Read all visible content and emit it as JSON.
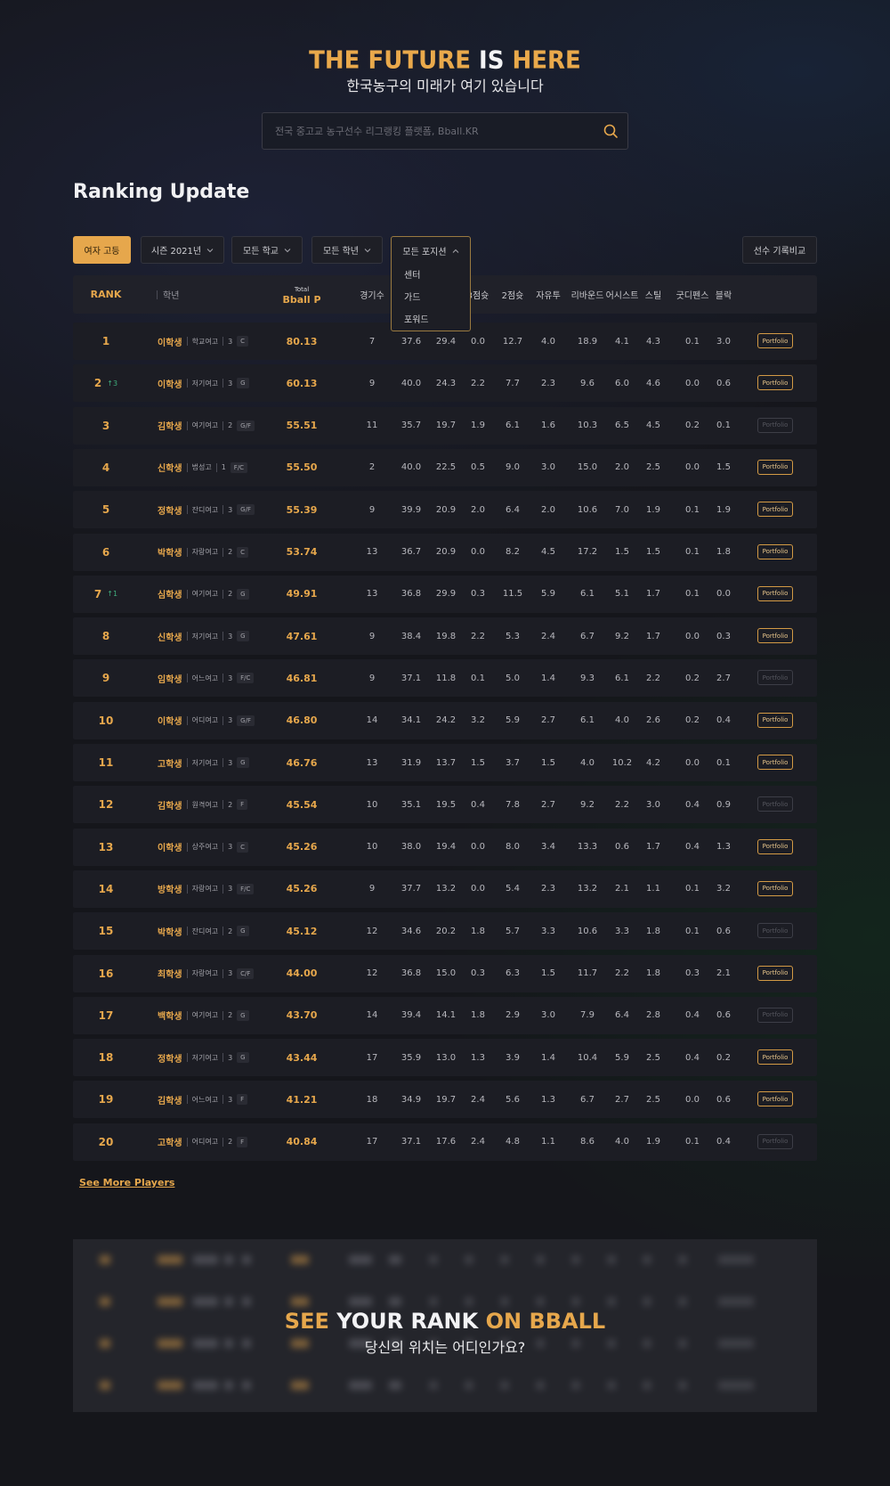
{
  "hero": {
    "title_a": "THE FUTURE",
    "title_b": "IS",
    "title_c": "HERE",
    "subtitle": "한국농구의 미래가 여기 있습니다"
  },
  "search": {
    "placeholder": "전국 중고교 농구선수 리그랭킹 플랫폼, Bball.KR",
    "icon": "search-icon"
  },
  "section_title": "Ranking Update",
  "filters": {
    "division": "여자 고등",
    "season": "시즌 2021년",
    "school": "모든 학교",
    "grade": "모든 학년",
    "position": "모든 포지션",
    "compare": "선수 기록비교"
  },
  "position_dropdown": {
    "options": [
      "센터",
      "가드",
      "포워드"
    ]
  },
  "table": {
    "columns": {
      "rank": "RANK",
      "year": "학년",
      "bp_small": "Total",
      "bp_big": "Bball P",
      "games": "경기수",
      "three": "3점슛",
      "two": "2점슛",
      "ft": "자유투",
      "reb": "리바운드",
      "ast": "어시스트",
      "stl": "스틸",
      "def": "굿디펜스",
      "blk": "블락"
    },
    "portfolio_label": "Portfolio",
    "rows": [
      {
        "rank": "1",
        "up": "",
        "name": "이학생",
        "school": "학교여고",
        "grade": "3",
        "pos": "C",
        "bp": "80.13",
        "g": "7",
        "a": "37.6",
        "b": "29.4",
        "s3": "0.0",
        "s2": "12.7",
        "ft": "4.0",
        "reb": "18.9",
        "ast": "4.1",
        "stl": "4.3",
        "def": "0.1",
        "blk": "3.0",
        "pf": true
      },
      {
        "rank": "2",
        "up": "↑3",
        "name": "이학생",
        "school": "저기여고",
        "grade": "3",
        "pos": "G",
        "bp": "60.13",
        "g": "9",
        "a": "40.0",
        "b": "24.3",
        "s3": "2.2",
        "s2": "7.7",
        "ft": "2.3",
        "reb": "9.6",
        "ast": "6.0",
        "stl": "4.6",
        "def": "0.0",
        "blk": "0.6",
        "pf": true
      },
      {
        "rank": "3",
        "up": "",
        "name": "김학생",
        "school": "여기여고",
        "grade": "2",
        "pos": "G/F",
        "bp": "55.51",
        "g": "11",
        "a": "35.7",
        "b": "19.7",
        "s3": "1.9",
        "s2": "6.1",
        "ft": "1.6",
        "reb": "10.3",
        "ast": "6.5",
        "stl": "4.5",
        "def": "0.2",
        "blk": "0.1",
        "pf": false
      },
      {
        "rank": "4",
        "up": "",
        "name": "신학생",
        "school": "법성고",
        "grade": "1",
        "pos": "F/C",
        "bp": "55.50",
        "g": "2",
        "a": "40.0",
        "b": "22.5",
        "s3": "0.5",
        "s2": "9.0",
        "ft": "3.0",
        "reb": "15.0",
        "ast": "2.0",
        "stl": "2.5",
        "def": "0.0",
        "blk": "1.5",
        "pf": true
      },
      {
        "rank": "5",
        "up": "",
        "name": "정학생",
        "school": "잔디여고",
        "grade": "3",
        "pos": "G/F",
        "bp": "55.39",
        "g": "9",
        "a": "39.9",
        "b": "20.9",
        "s3": "2.0",
        "s2": "6.4",
        "ft": "2.0",
        "reb": "10.6",
        "ast": "7.0",
        "stl": "1.9",
        "def": "0.1",
        "blk": "1.9",
        "pf": true
      },
      {
        "rank": "6",
        "up": "",
        "name": "박학생",
        "school": "자랑여고",
        "grade": "2",
        "pos": "C",
        "bp": "53.74",
        "g": "13",
        "a": "36.7",
        "b": "20.9",
        "s3": "0.0",
        "s2": "8.2",
        "ft": "4.5",
        "reb": "17.2",
        "ast": "1.5",
        "stl": "1.5",
        "def": "0.1",
        "blk": "1.8",
        "pf": true
      },
      {
        "rank": "7",
        "up": "↑1",
        "name": "심학생",
        "school": "여기여고",
        "grade": "2",
        "pos": "G",
        "bp": "49.91",
        "g": "13",
        "a": "36.8",
        "b": "29.9",
        "s3": "0.3",
        "s2": "11.5",
        "ft": "5.9",
        "reb": "6.1",
        "ast": "5.1",
        "stl": "1.7",
        "def": "0.1",
        "blk": "0.0",
        "pf": true
      },
      {
        "rank": "8",
        "up": "",
        "name": "신학생",
        "school": "저기여고",
        "grade": "3",
        "pos": "G",
        "bp": "47.61",
        "g": "9",
        "a": "38.4",
        "b": "19.8",
        "s3": "2.2",
        "s2": "5.3",
        "ft": "2.4",
        "reb": "6.7",
        "ast": "9.2",
        "stl": "1.7",
        "def": "0.0",
        "blk": "0.3",
        "pf": true
      },
      {
        "rank": "9",
        "up": "",
        "name": "임학생",
        "school": "어느여고",
        "grade": "3",
        "pos": "F/C",
        "bp": "46.81",
        "g": "9",
        "a": "37.1",
        "b": "11.8",
        "s3": "0.1",
        "s2": "5.0",
        "ft": "1.4",
        "reb": "9.3",
        "ast": "6.1",
        "stl": "2.2",
        "def": "0.2",
        "blk": "2.7",
        "pf": false
      },
      {
        "rank": "10",
        "up": "",
        "name": "이학생",
        "school": "어디여고",
        "grade": "3",
        "pos": "G/F",
        "bp": "46.80",
        "g": "14",
        "a": "34.1",
        "b": "24.2",
        "s3": "3.2",
        "s2": "5.9",
        "ft": "2.7",
        "reb": "6.1",
        "ast": "4.0",
        "stl": "2.6",
        "def": "0.2",
        "blk": "0.4",
        "pf": true
      },
      {
        "rank": "11",
        "up": "",
        "name": "고학생",
        "school": "저기여고",
        "grade": "3",
        "pos": "G",
        "bp": "46.76",
        "g": "13",
        "a": "31.9",
        "b": "13.7",
        "s3": "1.5",
        "s2": "3.7",
        "ft": "1.5",
        "reb": "4.0",
        "ast": "10.2",
        "stl": "4.2",
        "def": "0.0",
        "blk": "0.1",
        "pf": true
      },
      {
        "rank": "12",
        "up": "",
        "name": "김학생",
        "school": "원격여고",
        "grade": "2",
        "pos": "F",
        "bp": "45.54",
        "g": "10",
        "a": "35.1",
        "b": "19.5",
        "s3": "0.4",
        "s2": "7.8",
        "ft": "2.7",
        "reb": "9.2",
        "ast": "2.2",
        "stl": "3.0",
        "def": "0.4",
        "blk": "0.9",
        "pf": false
      },
      {
        "rank": "13",
        "up": "",
        "name": "이학생",
        "school": "상주여고",
        "grade": "3",
        "pos": "C",
        "bp": "45.26",
        "g": "10",
        "a": "38.0",
        "b": "19.4",
        "s3": "0.0",
        "s2": "8.0",
        "ft": "3.4",
        "reb": "13.3",
        "ast": "0.6",
        "stl": "1.7",
        "def": "0.4",
        "blk": "1.3",
        "pf": true
      },
      {
        "rank": "14",
        "up": "",
        "name": "방학생",
        "school": "자랑여고",
        "grade": "3",
        "pos": "F/C",
        "bp": "45.26",
        "g": "9",
        "a": "37.7",
        "b": "13.2",
        "s3": "0.0",
        "s2": "5.4",
        "ft": "2.3",
        "reb": "13.2",
        "ast": "2.1",
        "stl": "1.1",
        "def": "0.1",
        "blk": "3.2",
        "pf": true
      },
      {
        "rank": "15",
        "up": "",
        "name": "박학생",
        "school": "잔디여고",
        "grade": "2",
        "pos": "G",
        "bp": "45.12",
        "g": "12",
        "a": "34.6",
        "b": "20.2",
        "s3": "1.8",
        "s2": "5.7",
        "ft": "3.3",
        "reb": "10.6",
        "ast": "3.3",
        "stl": "1.8",
        "def": "0.1",
        "blk": "0.6",
        "pf": false
      },
      {
        "rank": "16",
        "up": "",
        "name": "최학생",
        "school": "자랑여고",
        "grade": "3",
        "pos": "C/F",
        "bp": "44.00",
        "g": "12",
        "a": "36.8",
        "b": "15.0",
        "s3": "0.3",
        "s2": "6.3",
        "ft": "1.5",
        "reb": "11.7",
        "ast": "2.2",
        "stl": "1.8",
        "def": "0.3",
        "blk": "2.1",
        "pf": true
      },
      {
        "rank": "17",
        "up": "",
        "name": "백학생",
        "school": "여기여고",
        "grade": "2",
        "pos": "G",
        "bp": "43.70",
        "g": "14",
        "a": "39.4",
        "b": "14.1",
        "s3": "1.8",
        "s2": "2.9",
        "ft": "3.0",
        "reb": "7.9",
        "ast": "6.4",
        "stl": "2.8",
        "def": "0.4",
        "blk": "0.6",
        "pf": false
      },
      {
        "rank": "18",
        "up": "",
        "name": "정학생",
        "school": "저기여고",
        "grade": "3",
        "pos": "G",
        "bp": "43.44",
        "g": "17",
        "a": "35.9",
        "b": "13.0",
        "s3": "1.3",
        "s2": "3.9",
        "ft": "1.4",
        "reb": "10.4",
        "ast": "5.9",
        "stl": "2.5",
        "def": "0.4",
        "blk": "0.2",
        "pf": true
      },
      {
        "rank": "19",
        "up": "",
        "name": "김학생",
        "school": "어느여고",
        "grade": "3",
        "pos": "F",
        "bp": "41.21",
        "g": "18",
        "a": "34.9",
        "b": "19.7",
        "s3": "2.4",
        "s2": "5.6",
        "ft": "1.3",
        "reb": "6.7",
        "ast": "2.7",
        "stl": "2.5",
        "def": "0.0",
        "blk": "0.6",
        "pf": true
      },
      {
        "rank": "20",
        "up": "",
        "name": "고학생",
        "school": "어디여고",
        "grade": "2",
        "pos": "F",
        "bp": "40.84",
        "g": "17",
        "a": "37.1",
        "b": "17.6",
        "s3": "2.4",
        "s2": "4.8",
        "ft": "1.1",
        "reb": "8.6",
        "ast": "4.0",
        "stl": "1.9",
        "def": "0.1",
        "blk": "0.4",
        "pf": false
      }
    ]
  },
  "see_more": "See More Players",
  "cta": {
    "title_a": "SEE",
    "title_b": "YOUR RANK",
    "title_c": "ON BBALL",
    "subtitle": "당신의 위치는 어디인가요?"
  },
  "colors": {
    "accent": "#e6a74c",
    "background": "#15161b",
    "row": "#1c1d24",
    "up": "#3fae7c"
  }
}
